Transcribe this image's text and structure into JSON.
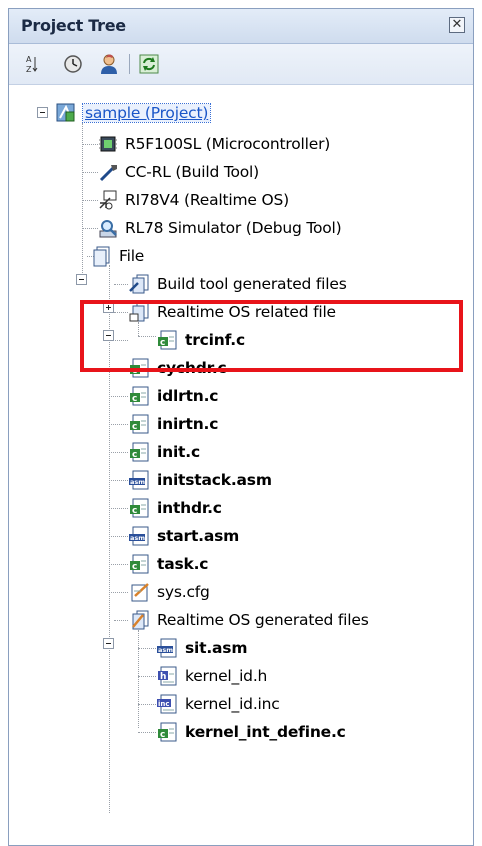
{
  "panel": {
    "title": "Project Tree"
  },
  "toolbar": {
    "buttons": [
      "sort-icon",
      "clock-icon",
      "user-icon",
      "refresh-icon"
    ]
  },
  "tree": {
    "project": "sample (Project)",
    "microcontroller": "R5F100SL (Microcontroller)",
    "build_tool": "CC-RL (Build Tool)",
    "realtime_os": "RI78V4 (Realtime OS)",
    "debug_tool": "RL78 Simulator (Debug Tool)",
    "file": "File",
    "build_generated": "Build tool generated files",
    "rtos_related": "Realtime OS related file",
    "rtos_related_files": [
      "trcinf.c"
    ],
    "files": [
      "cychdr.c",
      "idlrtn.c",
      "inirtn.c",
      "init.c",
      "initstack.asm",
      "inthdr.c",
      "start.asm",
      "task.c",
      "sys.cfg"
    ],
    "rtos_generated": "Realtime OS generated files",
    "rtos_generated_files": [
      "sit.asm",
      "kernel_id.h",
      "kernel_id.inc",
      "kernel_int_define.c"
    ]
  },
  "colors": {
    "highlight": "#e8141a",
    "selection": "#1a56c8"
  }
}
